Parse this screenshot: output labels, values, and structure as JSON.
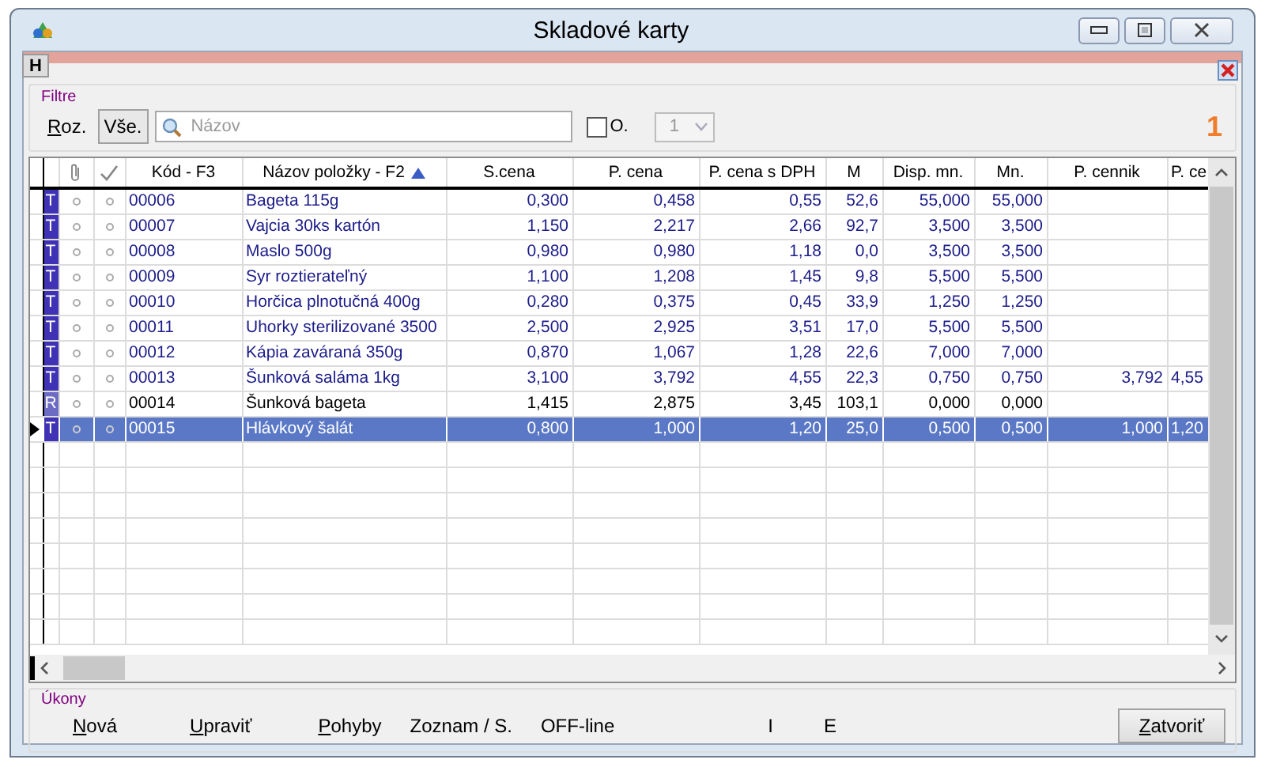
{
  "window": {
    "title": "Skladové karty"
  },
  "header_button": "H",
  "filter": {
    "label": "Filtre",
    "buttons": [
      {
        "label": "Roz.",
        "mnemonic": true,
        "raised": false
      },
      {
        "label": "Vše.",
        "mnemonic": false,
        "raised": true
      }
    ],
    "search": {
      "placeholder": "Názov"
    },
    "checkbox": {
      "label": "O.",
      "checked": false
    },
    "combo": {
      "value": "1",
      "disabled": true
    },
    "count": "1"
  },
  "table": {
    "columns": [
      {
        "label": "Kód - F3"
      },
      {
        "label": "Názov položky - F2",
        "sorted": true
      },
      {
        "label": "S.cena"
      },
      {
        "label": "P. cena"
      },
      {
        "label": "P. cena s DPH"
      },
      {
        "label": "M"
      },
      {
        "label": "Disp. mn."
      },
      {
        "label": "Mn."
      },
      {
        "label": "P. cennik"
      },
      {
        "label": "P. ce"
      }
    ],
    "rows": [
      {
        "type": "T",
        "color": "#3f32b4",
        "accent": true,
        "selected": false,
        "cells": [
          "00006",
          "Bageta 115g",
          "0,300",
          "0,458",
          "0,55",
          "52,6",
          "55,000",
          "55,000"
        ]
      },
      {
        "type": "T",
        "color": "#3f32b4",
        "accent": true,
        "selected": false,
        "cells": [
          "00007",
          "Vajcia 30ks kartón",
          "1,150",
          "2,217",
          "2,66",
          "92,7",
          "3,500",
          "3,500"
        ]
      },
      {
        "type": "T",
        "color": "#3f32b4",
        "accent": true,
        "selected": false,
        "cells": [
          "00008",
          "Maslo 500g",
          "0,980",
          "0,980",
          "1,18",
          "0,0",
          "3,500",
          "3,500"
        ]
      },
      {
        "type": "T",
        "color": "#3f32b4",
        "accent": true,
        "selected": false,
        "cells": [
          "00009",
          "Syr roztierateľný",
          "1,100",
          "1,208",
          "1,45",
          "9,8",
          "5,500",
          "5,500"
        ]
      },
      {
        "type": "T",
        "color": "#3f32b4",
        "accent": true,
        "selected": false,
        "cells": [
          "00010",
          "Horčica plnotučná 400g",
          "0,280",
          "0,375",
          "0,45",
          "33,9",
          "1,250",
          "1,250"
        ]
      },
      {
        "type": "T",
        "color": "#3f32b4",
        "accent": true,
        "selected": false,
        "cells": [
          "00011",
          "Uhorky sterilizované 3500",
          "2,500",
          "2,925",
          "3,51",
          "17,0",
          "5,500",
          "5,500"
        ]
      },
      {
        "type": "T",
        "color": "#3f32b4",
        "accent": true,
        "selected": false,
        "cells": [
          "00012",
          "Kápia zaváraná 350g",
          "0,870",
          "1,067",
          "1,28",
          "22,6",
          "7,000",
          "7,000"
        ]
      },
      {
        "type": "T",
        "color": "#3f32b4",
        "accent": true,
        "selected": false,
        "cells": [
          "00013",
          "Šunková saláma 1kg",
          "3,100",
          "3,792",
          "4,55",
          "22,3",
          "0,750",
          "0,750",
          "3,792",
          "4,55"
        ]
      },
      {
        "type": "R",
        "color": "#6d6cc4",
        "accent": false,
        "selected": false,
        "cells": [
          "00014",
          "Šunková bageta",
          "1,415",
          "2,875",
          "3,45",
          "103,1",
          "0,000",
          "0,000"
        ]
      },
      {
        "type": "T",
        "color": "#3f32b4",
        "accent": true,
        "selected": true,
        "cells": [
          "00015",
          "Hlávkový šalát",
          "0,800",
          "1,000",
          "1,20",
          "25,0",
          "0,500",
          "0,500",
          "1,000",
          "1,20"
        ]
      }
    ]
  },
  "actions": {
    "label": "Úkony",
    "items": [
      {
        "label": "Nová",
        "mnemonic": true
      },
      {
        "label": "Upraviť",
        "mnemonic": true
      },
      {
        "label": "Pohyby",
        "mnemonic": true
      },
      {
        "label": "Zoznam / S.",
        "mnemonic": false
      },
      {
        "label": "OFF-line",
        "mnemonic": false
      },
      {
        "label": "I",
        "mnemonic": false
      },
      {
        "label": "E",
        "mnemonic": false
      }
    ],
    "close": {
      "label": "Zatvoriť",
      "mnemonic": true
    }
  }
}
